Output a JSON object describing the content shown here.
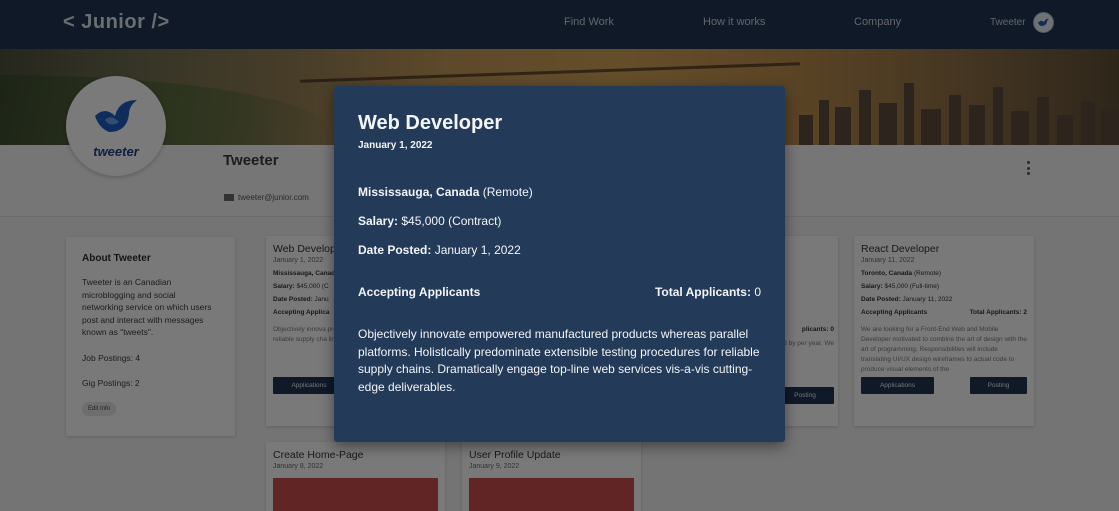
{
  "nav": {
    "logo": "< Junior />",
    "links": [
      "Find Work",
      "How it works",
      "Company"
    ],
    "user": "Tweeter",
    "avatar_icon": "bird-avatar-icon"
  },
  "profile": {
    "logo_word": "tweeter",
    "name": "Tweeter",
    "email": "tweeter@junior.com"
  },
  "about": {
    "title": "About Tweeter",
    "text": "Tweeter is an Canadian microblogging and social networking service on which users post and interact with messages known as \"tweets\".",
    "job_postings": "Job Postings: 4",
    "gig_postings": "Gig Postings: 2",
    "edit_label": "Edit Info"
  },
  "cards": {
    "web": {
      "title": "Web Developer",
      "date": "January 1, 2022",
      "location": "Mississauga, Canad",
      "salary": "$45,000 (C",
      "date_posted": "Janu",
      "accepting": "Accepting Applica",
      "desc": "Objectively innova products whereas predominate exten reliable supply cha line web services v",
      "btn_applications": "Applications"
    },
    "hidden": {
      "desc": "vely with our mers, and new features ode used by per year. We",
      "applicants_fragment": "plicants: 0",
      "btn_posting": "Posting"
    },
    "react": {
      "title": "React Developer",
      "date": "January 11, 2022",
      "location_strong": "Toronto, Canada",
      "location_type": "(Remote)",
      "salary": "$45,000 (Full-time)",
      "date_posted": "January 11, 2022",
      "accepting": "Accepting Applicants",
      "total_label": "Total Applicants:",
      "total": "2",
      "desc": "We are looking for a Front-End Web and Mobile Developer motivated to combine the art of design with the art of programming. Responsibilities will include translating UI/UX design wireframes to actual code to produce visual elements of the",
      "btn_applications": "Applications",
      "btn_posting": "Posting"
    },
    "gig1": {
      "title": "Create Home-Page",
      "date": "January 8, 2022"
    },
    "gig2": {
      "title": "User Profile Update",
      "date": "January 9, 2022"
    },
    "labels": {
      "salary": "Salary:",
      "date_posted": "Date Posted:"
    }
  },
  "modal": {
    "title": "Web Developer",
    "date": "January 1, 2022",
    "location_strong": "Mississauga, Canada",
    "location_type": "(Remote)",
    "salary_label": "Salary:",
    "salary": "$45,000 (Contract)",
    "date_posted_label": "Date Posted:",
    "date_posted": "January 1, 2022",
    "accepting": "Accepting Applicants",
    "total_label": "Total Applicants:",
    "total": "0",
    "description": "Objectively innovate empowered manufactured products whereas parallel platforms. Holistically predominate extensible testing procedures for reliable supply chains. Dramatically engage top-line web services vis-a-vis cutting-edge deliverables."
  },
  "colors": {
    "navy": "#1e3350",
    "modal": "#233b59",
    "gig_thumb": "#c44b4b"
  }
}
